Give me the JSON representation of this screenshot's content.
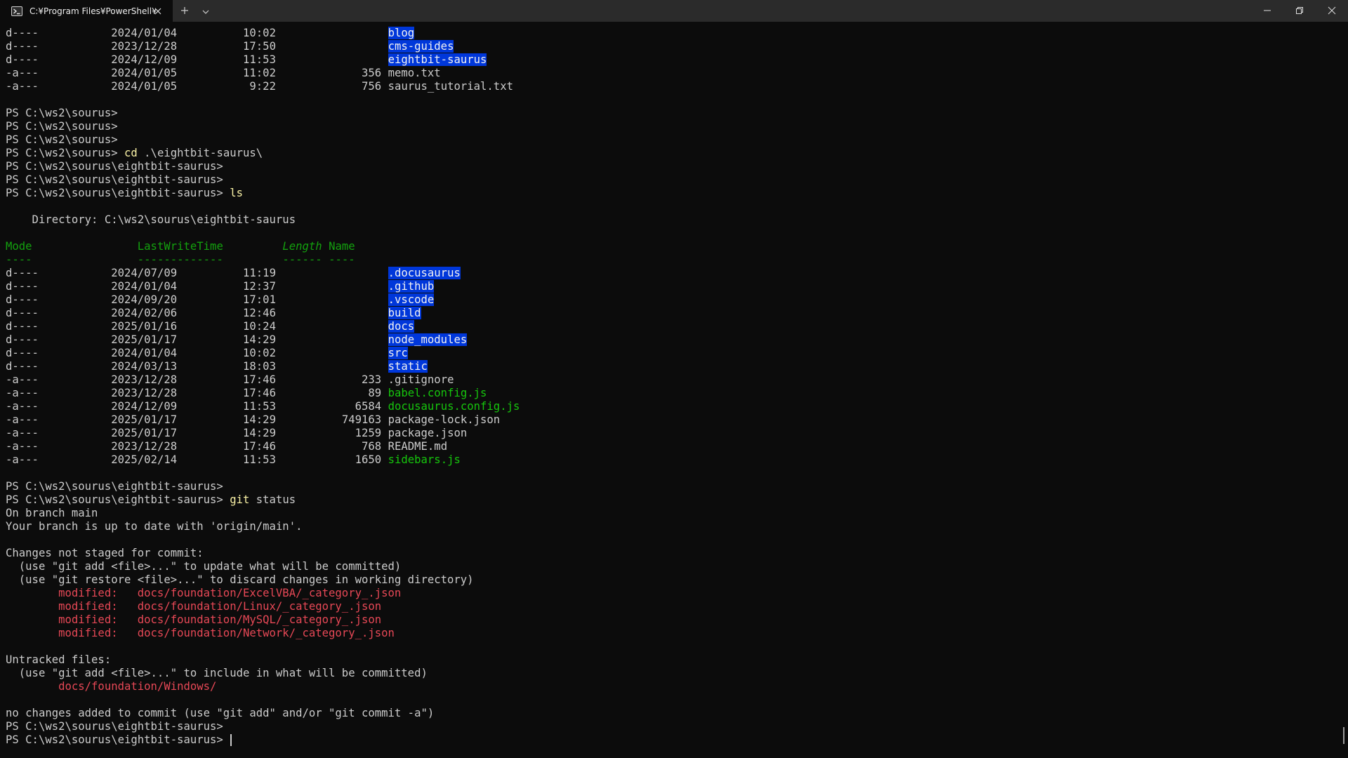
{
  "window": {
    "tab_title": "C:¥Program Files¥PowerShell¥",
    "icons": {
      "tab": "powershell-icon",
      "close_tab": "close-icon",
      "new_tab": "plus-icon",
      "dropdown": "chevron-down-icon",
      "minimize": "minimize-icon",
      "maximize": "restore-icon",
      "close_window": "close-icon"
    }
  },
  "colors": {
    "background": "#0c0c0c",
    "foreground": "#cccccc",
    "directory_highlight": "#0037da",
    "js_file": "#16c60c",
    "header": "#13a10e",
    "command": "#f9f1a5",
    "git_red": "#e74856"
  },
  "terminal": {
    "top_listing": [
      {
        "mode": "d----",
        "date": "2024/01/04",
        "time": "10:02",
        "length": "",
        "name": "blog",
        "type": "dir"
      },
      {
        "mode": "d----",
        "date": "2023/12/28",
        "time": "17:50",
        "length": "",
        "name": "cms-guides",
        "type": "dir"
      },
      {
        "mode": "d----",
        "date": "2024/12/09",
        "time": "11:53",
        "length": "",
        "name": "eightbit-saurus",
        "type": "dir"
      },
      {
        "mode": "-a---",
        "date": "2024/01/05",
        "time": "11:02",
        "length": "356",
        "name": "memo.txt",
        "type": "file"
      },
      {
        "mode": "-a---",
        "date": "2024/01/05",
        "time": "9:22",
        "length": "756",
        "name": "saurus_tutorial.txt",
        "type": "file"
      }
    ],
    "prompt_sourus": "PS C:\\ws2\\sourus>",
    "prompt_eightbit": "PS C:\\ws2\\sourus\\eightbit-saurus>",
    "cmd_cd": "cd",
    "cmd_cd_arg": ".\\eightbit-saurus\\",
    "cmd_ls": "ls",
    "directory_line": "    Directory: C:\\ws2\\sourus\\eightbit-saurus",
    "headers": {
      "mode": "Mode",
      "lastwritetime": "LastWriteTime",
      "length": "Length",
      "name": "Name",
      "mode_ul": "----",
      "lastwritetime_ul": "-------------",
      "length_ul": "------",
      "name_ul": "----"
    },
    "listing": [
      {
        "mode": "d----",
        "date": "2024/07/09",
        "time": "11:19",
        "length": "",
        "name": ".docusaurus",
        "type": "dir"
      },
      {
        "mode": "d----",
        "date": "2024/01/04",
        "time": "12:37",
        "length": "",
        "name": ".github",
        "type": "dir"
      },
      {
        "mode": "d----",
        "date": "2024/09/20",
        "time": "17:01",
        "length": "",
        "name": ".vscode",
        "type": "dir"
      },
      {
        "mode": "d----",
        "date": "2024/02/06",
        "time": "12:46",
        "length": "",
        "name": "build",
        "type": "dir"
      },
      {
        "mode": "d----",
        "date": "2025/01/16",
        "time": "10:24",
        "length": "",
        "name": "docs",
        "type": "dir"
      },
      {
        "mode": "d----",
        "date": "2025/01/17",
        "time": "14:29",
        "length": "",
        "name": "node_modules",
        "type": "dir"
      },
      {
        "mode": "d----",
        "date": "2024/01/04",
        "time": "10:02",
        "length": "",
        "name": "src",
        "type": "dir"
      },
      {
        "mode": "d----",
        "date": "2024/03/13",
        "time": "18:03",
        "length": "",
        "name": "static",
        "type": "dir"
      },
      {
        "mode": "-a---",
        "date": "2023/12/28",
        "time": "17:46",
        "length": "233",
        "name": ".gitignore",
        "type": "file"
      },
      {
        "mode": "-a---",
        "date": "2023/12/28",
        "time": "17:46",
        "length": "89",
        "name": "babel.config.js",
        "type": "js"
      },
      {
        "mode": "-a---",
        "date": "2024/12/09",
        "time": "11:53",
        "length": "6584",
        "name": "docusaurus.config.js",
        "type": "js"
      },
      {
        "mode": "-a---",
        "date": "2025/01/17",
        "time": "14:29",
        "length": "749163",
        "name": "package-lock.json",
        "type": "file"
      },
      {
        "mode": "-a---",
        "date": "2025/01/17",
        "time": "14:29",
        "length": "1259",
        "name": "package.json",
        "type": "file"
      },
      {
        "mode": "-a---",
        "date": "2023/12/28",
        "time": "17:46",
        "length": "768",
        "name": "README.md",
        "type": "file"
      },
      {
        "mode": "-a---",
        "date": "2025/02/14",
        "time": "11:53",
        "length": "1650",
        "name": "sidebars.js",
        "type": "js"
      }
    ],
    "cmd_git": "git",
    "cmd_git_arg": "status",
    "git": {
      "branch": "On branch main",
      "up_to_date": "Your branch is up to date with 'origin/main'.",
      "not_staged_header": "Changes not staged for commit:",
      "hint_add": "  (use \"git add <file>...\" to update what will be committed)",
      "hint_restore": "  (use \"git restore <file>...\" to discard changes in working directory)",
      "modified": [
        "        modified:   docs/foundation/ExcelVBA/_category_.json",
        "        modified:   docs/foundation/Linux/_category_.json",
        "        modified:   docs/foundation/MySQL/_category_.json",
        "        modified:   docs/foundation/Network/_category_.json"
      ],
      "untracked_header": "Untracked files:",
      "hint_include": "  (use \"git add <file>...\" to include in what will be committed)",
      "untracked": "        docs/foundation/Windows/",
      "summary": "no changes added to commit (use \"git add\" and/or \"git commit -a\")"
    }
  }
}
